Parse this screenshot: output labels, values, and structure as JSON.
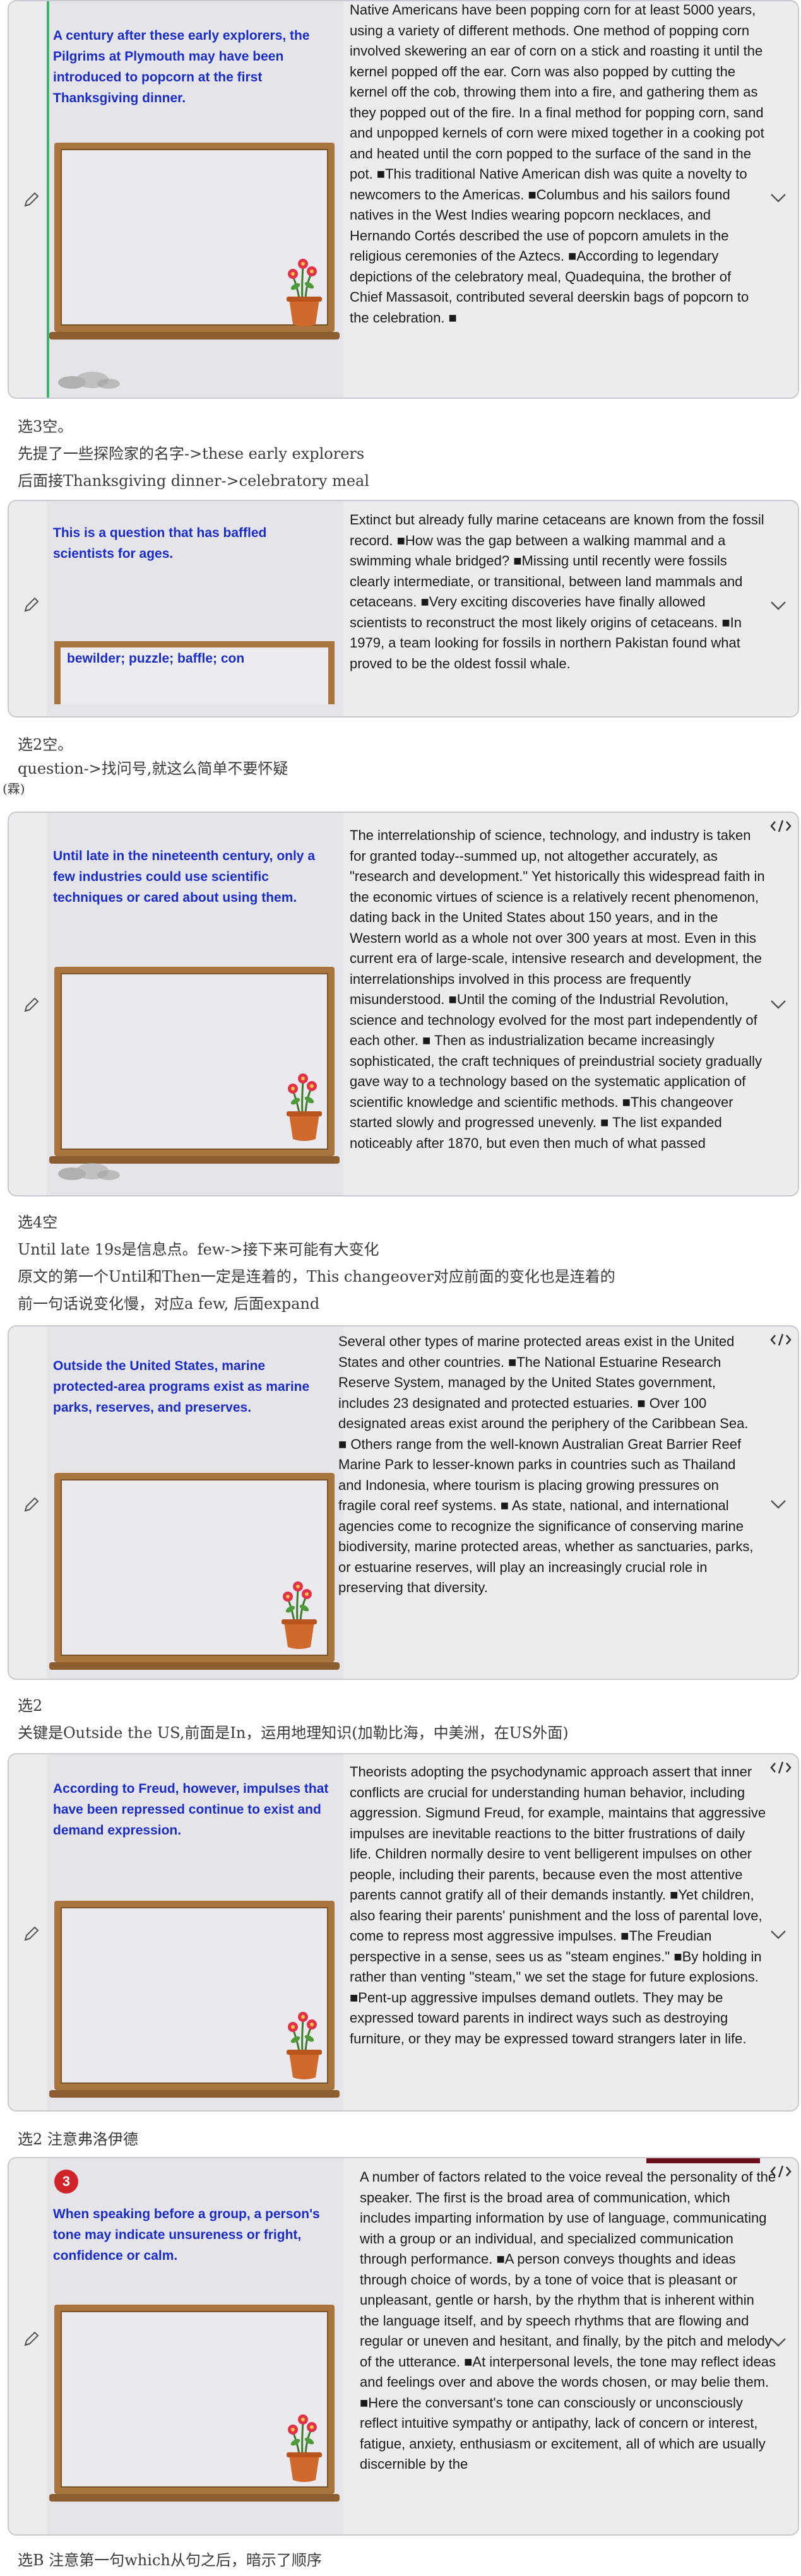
{
  "cards": [
    {
      "prompt": "A century after these early explorers, the Pilgrims at Plymouth may have been introduced to popcorn at the first Thanksgiving dinner.",
      "passage": "Native Americans have been popping corn for at least 5000 years, using a variety of different methods. One method of popping corn involved skewering an ear of corn on a stick and roasting it until the kernel popped off the ear. Corn was also popped by cutting the kernel off the cob, throwing them into a fire, and gathering them as they popped out of the fire. In a final method for popping corn, sand and unpopped kernels of corn were mixed together in a cooking pot and heated until the corn popped to the surface of the sand in the pot. ■This traditional Native American dish was quite a novelty to newcomers to the Americas. ■Columbus and his sailors found natives in the West Indies wearing popcorn necklaces, and Hernando Cortés described the use of popcorn amulets in the religious ceremonies of the Aztecs. ■According to legendary depictions of the celebratory meal, Quadequina, the brother of Chief Massasoit, contributed several deerskin bags of popcorn to the celebration. ■"
    },
    {
      "prompt": "This is a question that has baffled scientists for ages.",
      "answer": "bewilder; puzzle; baffle; con",
      "passage": "Extinct but already fully marine cetaceans are known from the fossil record. ■How was the gap between a walking mammal and a swimming whale bridged? ■Missing until recently were fossils clearly intermediate, or transitional, between land mammals and cetaceans. ■Very exciting discoveries have finally allowed scientists to reconstruct the most likely origins of cetaceans. ■In 1979, a team looking for fossils in northern Pakistan found what proved to be the oldest fossil whale."
    },
    {
      "prompt": "Until late in the nineteenth century, only a few industries could use scientific techniques or cared about using them.",
      "passage": "The interrelationship of science, technology, and industry is taken for granted today--summed up, not altogether accurately, as \"research and development.\" Yet historically this widespread faith in the economic virtues of science is a relatively recent phenomenon, dating back in the United States about 150 years, and in the Western world as a whole not over 300 years at most. Even in this current era of large-scale, intensive research and development, the interrelationships involved in this process are frequently misunderstood. ■Until the coming of the Industrial Revolution, science and technology evolved for the most part independently of each other. ■ Then as industrialization became increasingly sophisticated, the craft techniques of preindustrial society gradually gave way to a technology based on the systematic application of scientific knowledge and scientific methods. ■This changeover started slowly and progressed unevenly. ■ The list expanded noticeably after 1870, but even then much of what passed"
    },
    {
      "prompt": "Outside the United States, marine protected-area programs exist as marine parks, reserves, and preserves.",
      "passage": "Several other types of marine protected areas exist in the United States and other countries. ■The National Estuarine Research Reserve System, managed by the United States government, includes 23 designated and protected estuaries. ■ Over 100 designated areas exist around the periphery of the Caribbean Sea. ■ Others range from the well-known Australian Great Barrier Reef Marine Park to lesser-known parks in countries such as Thailand and Indonesia, where tourism is placing growing pressures on fragile coral reef systems. ■ As state, national, and international agencies come to recognize the significance of conserving marine biodiversity, marine protected areas, whether as sanctuaries, parks, or estuarine reserves, will play an increasingly crucial role in preserving that diversity."
    },
    {
      "prompt": "According to Freud, however, impulses that have been repressed continue to exist and demand expression.",
      "passage": "Theorists adopting the psychodynamic approach assert that inner conflicts are crucial for understanding human behavior, including aggression. Sigmund Freud, for example, maintains that aggressive impulses are inevitable reactions to the bitter frustrations of daily life. Children normally desire to vent belligerent impulses on other people, including their parents, because even the most attentive parents cannot gratify all of their demands instantly. ■Yet children, also fearing their parents' punishment and the loss of parental love, come to repress most aggressive impulses. ■The Freudian perspective in a sense, sees us as \"steam engines.\" ■By holding in rather than venting \"steam,\" we set the stage for future explosions. ■Pent-up aggressive impulses demand outlets. They may be expressed toward parents in indirect ways such as destroying furniture, or they may be expressed toward strangers later in life."
    },
    {
      "badge": "3",
      "prompt": "When speaking before a group, a person's tone may indicate unsureness or fright, confidence or calm.",
      "passage": "A number of factors related to the voice reveal the personality of the speaker. The first is the broad area of communication, which includes imparting information by use of language, communicating with a group or an individual, and specialized communication through performance. ■A person conveys thoughts and ideas through choice of words, by a tone of voice that is pleasant or unpleasant, gentle or harsh, by the rhythm that is inherent within the language itself, and by speech rhythms that are flowing and regular or uneven and hesitant, and finally, by the pitch and melody of the utterance. ■At interpersonal levels, the tone may reflect ideas and feelings over and above the words chosen, or may belie them. ■Here the conversant's tone can consciously or unconsciously reflect intuitive sympathy or antipathy, lack of concern or interest, fatigue, anxiety, enthusiasm or excitement, all of which are usually discernible by the"
    }
  ],
  "notes": {
    "n1": [
      "选3空。",
      "先提了一些探险家的名字->these early explorers",
      "后面接Thanksgiving dinner->celebratory meal"
    ],
    "n2": [
      "选2空。",
      "question->找问号,就这么简单不要怀疑",
      "(霖)"
    ],
    "n3": [
      "选4空",
      "Until late 19s是信息点。few->接下来可能有大变化",
      "原文的第一个Until和Then一定是连着的，This changeover对应前面的变化也是连着的",
      "前一句话说变化慢，对应a few, 后面expand"
    ],
    "n4": [
      "选2",
      "关键是Outside the US,前面是In，运用地理知识(加勒比海，中美洲，在US外面)"
    ],
    "n5": [
      "选2 注意弗洛伊德"
    ],
    "n6": [
      "选B 注意第一句which从句之后，暗示了顺序"
    ]
  }
}
